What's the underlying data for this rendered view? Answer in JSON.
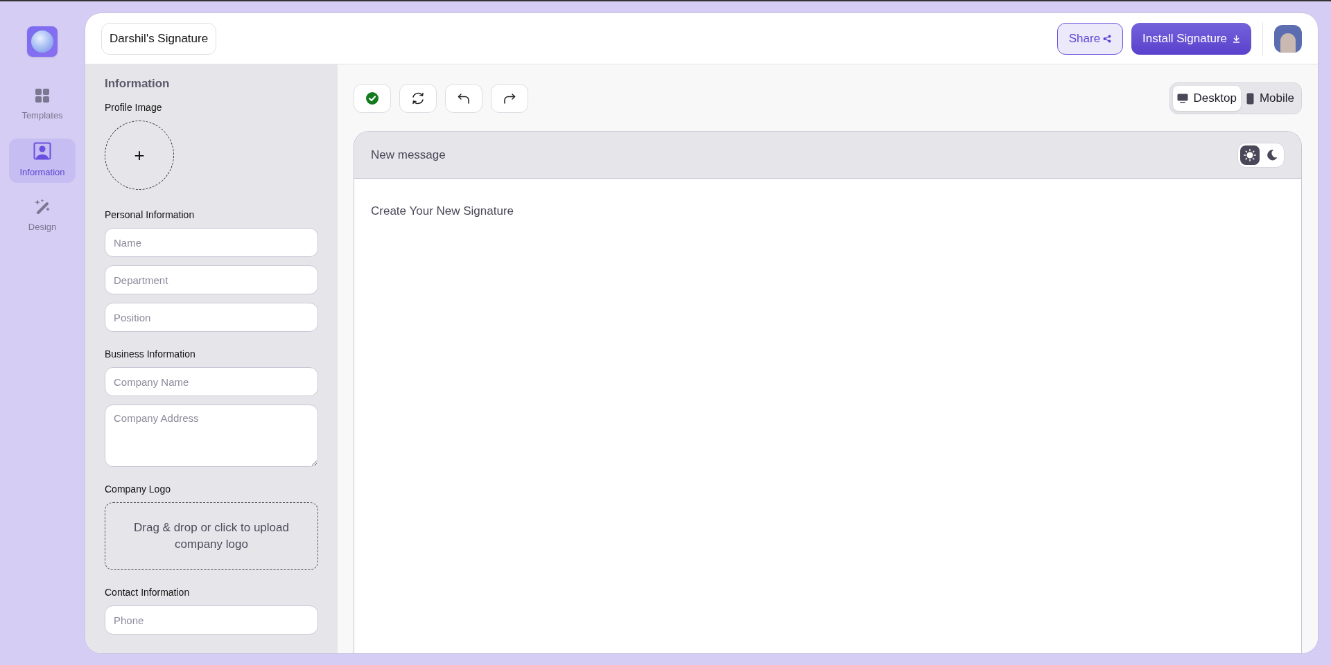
{
  "sidebar": {
    "items": [
      {
        "label": "Templates",
        "kind": "grid",
        "selected": false
      },
      {
        "label": "Information",
        "kind": "person",
        "selected": true
      },
      {
        "label": "Design",
        "kind": "wand",
        "selected": false
      }
    ]
  },
  "header": {
    "title": "Darshil's Signature",
    "share_button": "Share",
    "install_button": "Install Signature"
  },
  "form": {
    "heading": "Information",
    "profile_image_label": "Profile Image",
    "profile_image_button": "+",
    "sections": [
      {
        "label": "Personal Information",
        "fields": [
          {
            "placeholder": "Name",
            "kind": "input"
          },
          {
            "placeholder": "Department",
            "kind": "input"
          },
          {
            "placeholder": "Position",
            "kind": "input"
          }
        ]
      },
      {
        "label": "Business Information",
        "fields": [
          {
            "placeholder": "Company Name",
            "kind": "input"
          },
          {
            "placeholder": "Company Address",
            "kind": "textarea"
          }
        ]
      },
      {
        "label": "Company Logo",
        "fields": [
          {
            "placeholder": "Drag & drop or click to upload company logo",
            "kind": "upload"
          }
        ]
      },
      {
        "label": "Contact Information",
        "fields": [
          {
            "placeholder": "Phone",
            "kind": "input"
          }
        ]
      }
    ]
  },
  "toolbar": [
    {
      "kind": "check"
    },
    {
      "kind": "refresh"
    },
    {
      "kind": "undo"
    },
    {
      "kind": "redo"
    }
  ],
  "view_toggle": [
    {
      "label": "Desktop",
      "kind": "desktop",
      "selected": true
    },
    {
      "label": "Mobile",
      "kind": "mobile",
      "selected": false
    }
  ],
  "preview": {
    "title": "New message",
    "body": "Create Your New Signature",
    "theme": [
      {
        "kind": "light",
        "selected": true
      },
      {
        "kind": "dark",
        "selected": false
      }
    ]
  }
}
